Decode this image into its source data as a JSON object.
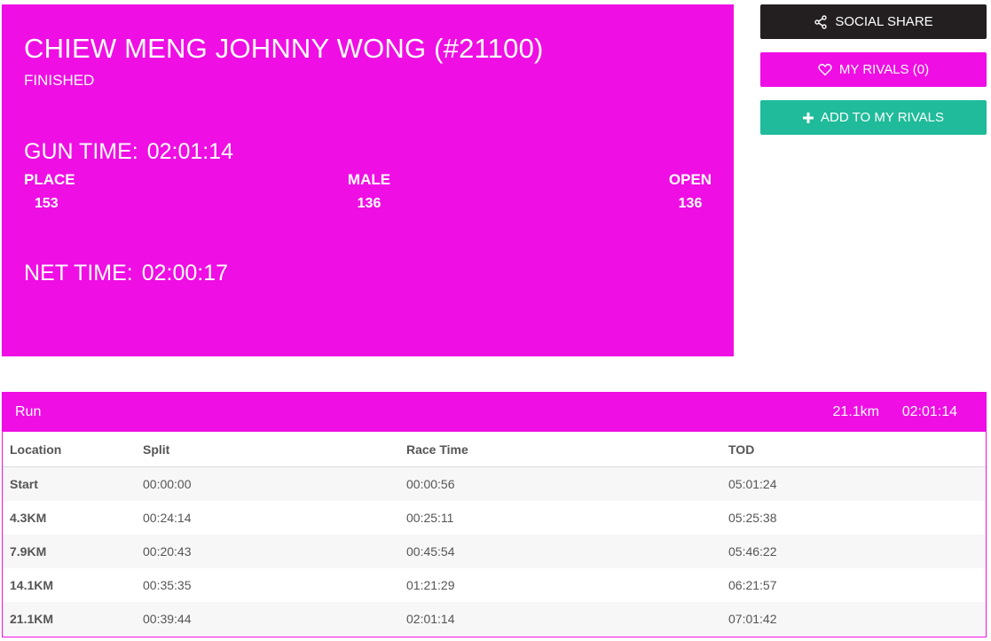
{
  "athlete": {
    "name": "CHIEW MENG JOHNNY WONG (#21100)",
    "status": "FINISHED"
  },
  "gun_time": {
    "label": "GUN TIME:",
    "value": "02:01:14"
  },
  "net_time": {
    "label": "NET TIME:",
    "value": "02:00:17"
  },
  "placings": [
    {
      "label": "PLACE",
      "value": "153"
    },
    {
      "label": "MALE",
      "value": "136"
    },
    {
      "label": "OPEN",
      "value": "136"
    }
  ],
  "actions": {
    "social_share": "SOCIAL SHARE",
    "my_rivals": "MY RIVALS (0)",
    "add_rivals": "ADD TO MY RIVALS"
  },
  "splits": {
    "leg_name": "Run",
    "distance": "21.1km",
    "total_time": "02:01:14",
    "columns": [
      "Location",
      "Split",
      "Race Time",
      "TOD"
    ],
    "rows": [
      {
        "location": "Start",
        "split": "00:00:00",
        "race_time": "00:00:56",
        "tod": "05:01:24"
      },
      {
        "location": "4.3KM",
        "split": "00:24:14",
        "race_time": "00:25:11",
        "tod": "05:25:38"
      },
      {
        "location": "7.9KM",
        "split": "00:20:43",
        "race_time": "00:45:54",
        "tod": "05:46:22"
      },
      {
        "location": "14.1KM",
        "split": "00:35:35",
        "race_time": "01:21:29",
        "tod": "06:21:57"
      },
      {
        "location": "21.1KM",
        "split": "00:39:44",
        "race_time": "02:01:14",
        "tod": "07:01:42"
      }
    ]
  },
  "icons": {
    "share": "share-icon",
    "heart": "heart-icon",
    "plus": "plus-icon"
  },
  "colors": {
    "accent": "#ef0ee4",
    "share_button": "#231f20",
    "add_button": "#1fbb9a"
  }
}
